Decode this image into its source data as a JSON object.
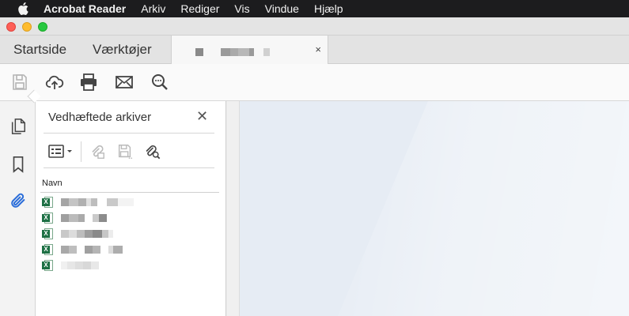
{
  "menubar": {
    "app_name": "Acrobat Reader",
    "items": [
      "Arkiv",
      "Rediger",
      "Vis",
      "Vindue",
      "Hjælp"
    ]
  },
  "tabs": {
    "home": "Startside",
    "tools": "Værktøjer",
    "close": "×"
  },
  "toolbar": {
    "icons": [
      "save-icon",
      "upload-cloud-icon",
      "print-icon",
      "email-icon",
      "search-zoom-icon"
    ]
  },
  "leftnav": {
    "icons": [
      "page-thumbnails-icon",
      "bookmark-icon",
      "attachment-paperclip-icon"
    ]
  },
  "attachments_panel": {
    "title": "Vedhæftede arkiver",
    "close": "✕",
    "column_header": "Navn",
    "file_icon_label": "X",
    "files_count_visible": 5
  },
  "colors": {
    "menubar_bg": "#1c1c1e",
    "excel_green": "#1d7044",
    "accent_blue": "#2a6dd9",
    "doc_bg": "#e6ecf4"
  }
}
